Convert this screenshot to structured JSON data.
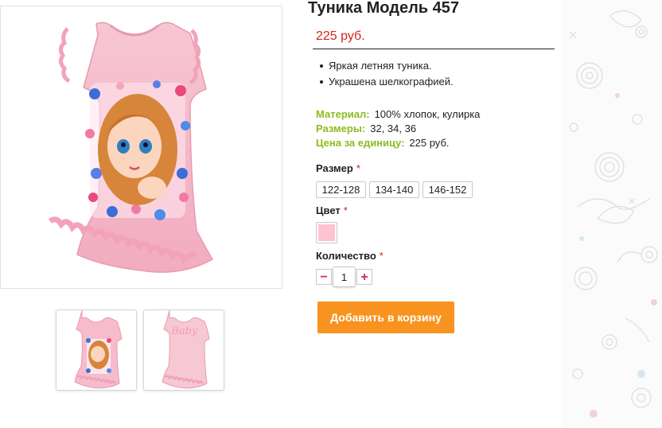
{
  "product": {
    "title": "Туника Модель 457",
    "price": "225 руб.",
    "bullets": [
      "Яркая летняя туника.",
      "Украшена шелкографией."
    ],
    "specs": [
      {
        "key": "Материал:",
        "value": "100% хлопок, кулирка"
      },
      {
        "key": "Размеры:",
        "value": "32, 34, 36"
      },
      {
        "key": "Цена за единицу:",
        "value": "225 руб."
      }
    ],
    "thumb_back_text": "Baby"
  },
  "options": {
    "size_label": "Размер",
    "color_label": "Цвет",
    "quantity_label": "Количество",
    "required_mark": "*",
    "sizes": [
      "122-128",
      "134-140",
      "146-152"
    ],
    "color_swatch": "#ffc3d0"
  },
  "quantity": {
    "value": "1",
    "minus": "−",
    "plus": "+"
  },
  "cart": {
    "add_label": "Добавить в корзину"
  },
  "colors": {
    "accent_orange": "#f7931e",
    "price_red": "#d8231a",
    "spec_green": "#8cbb1e",
    "shirt_pink": "#f4b4c5"
  }
}
